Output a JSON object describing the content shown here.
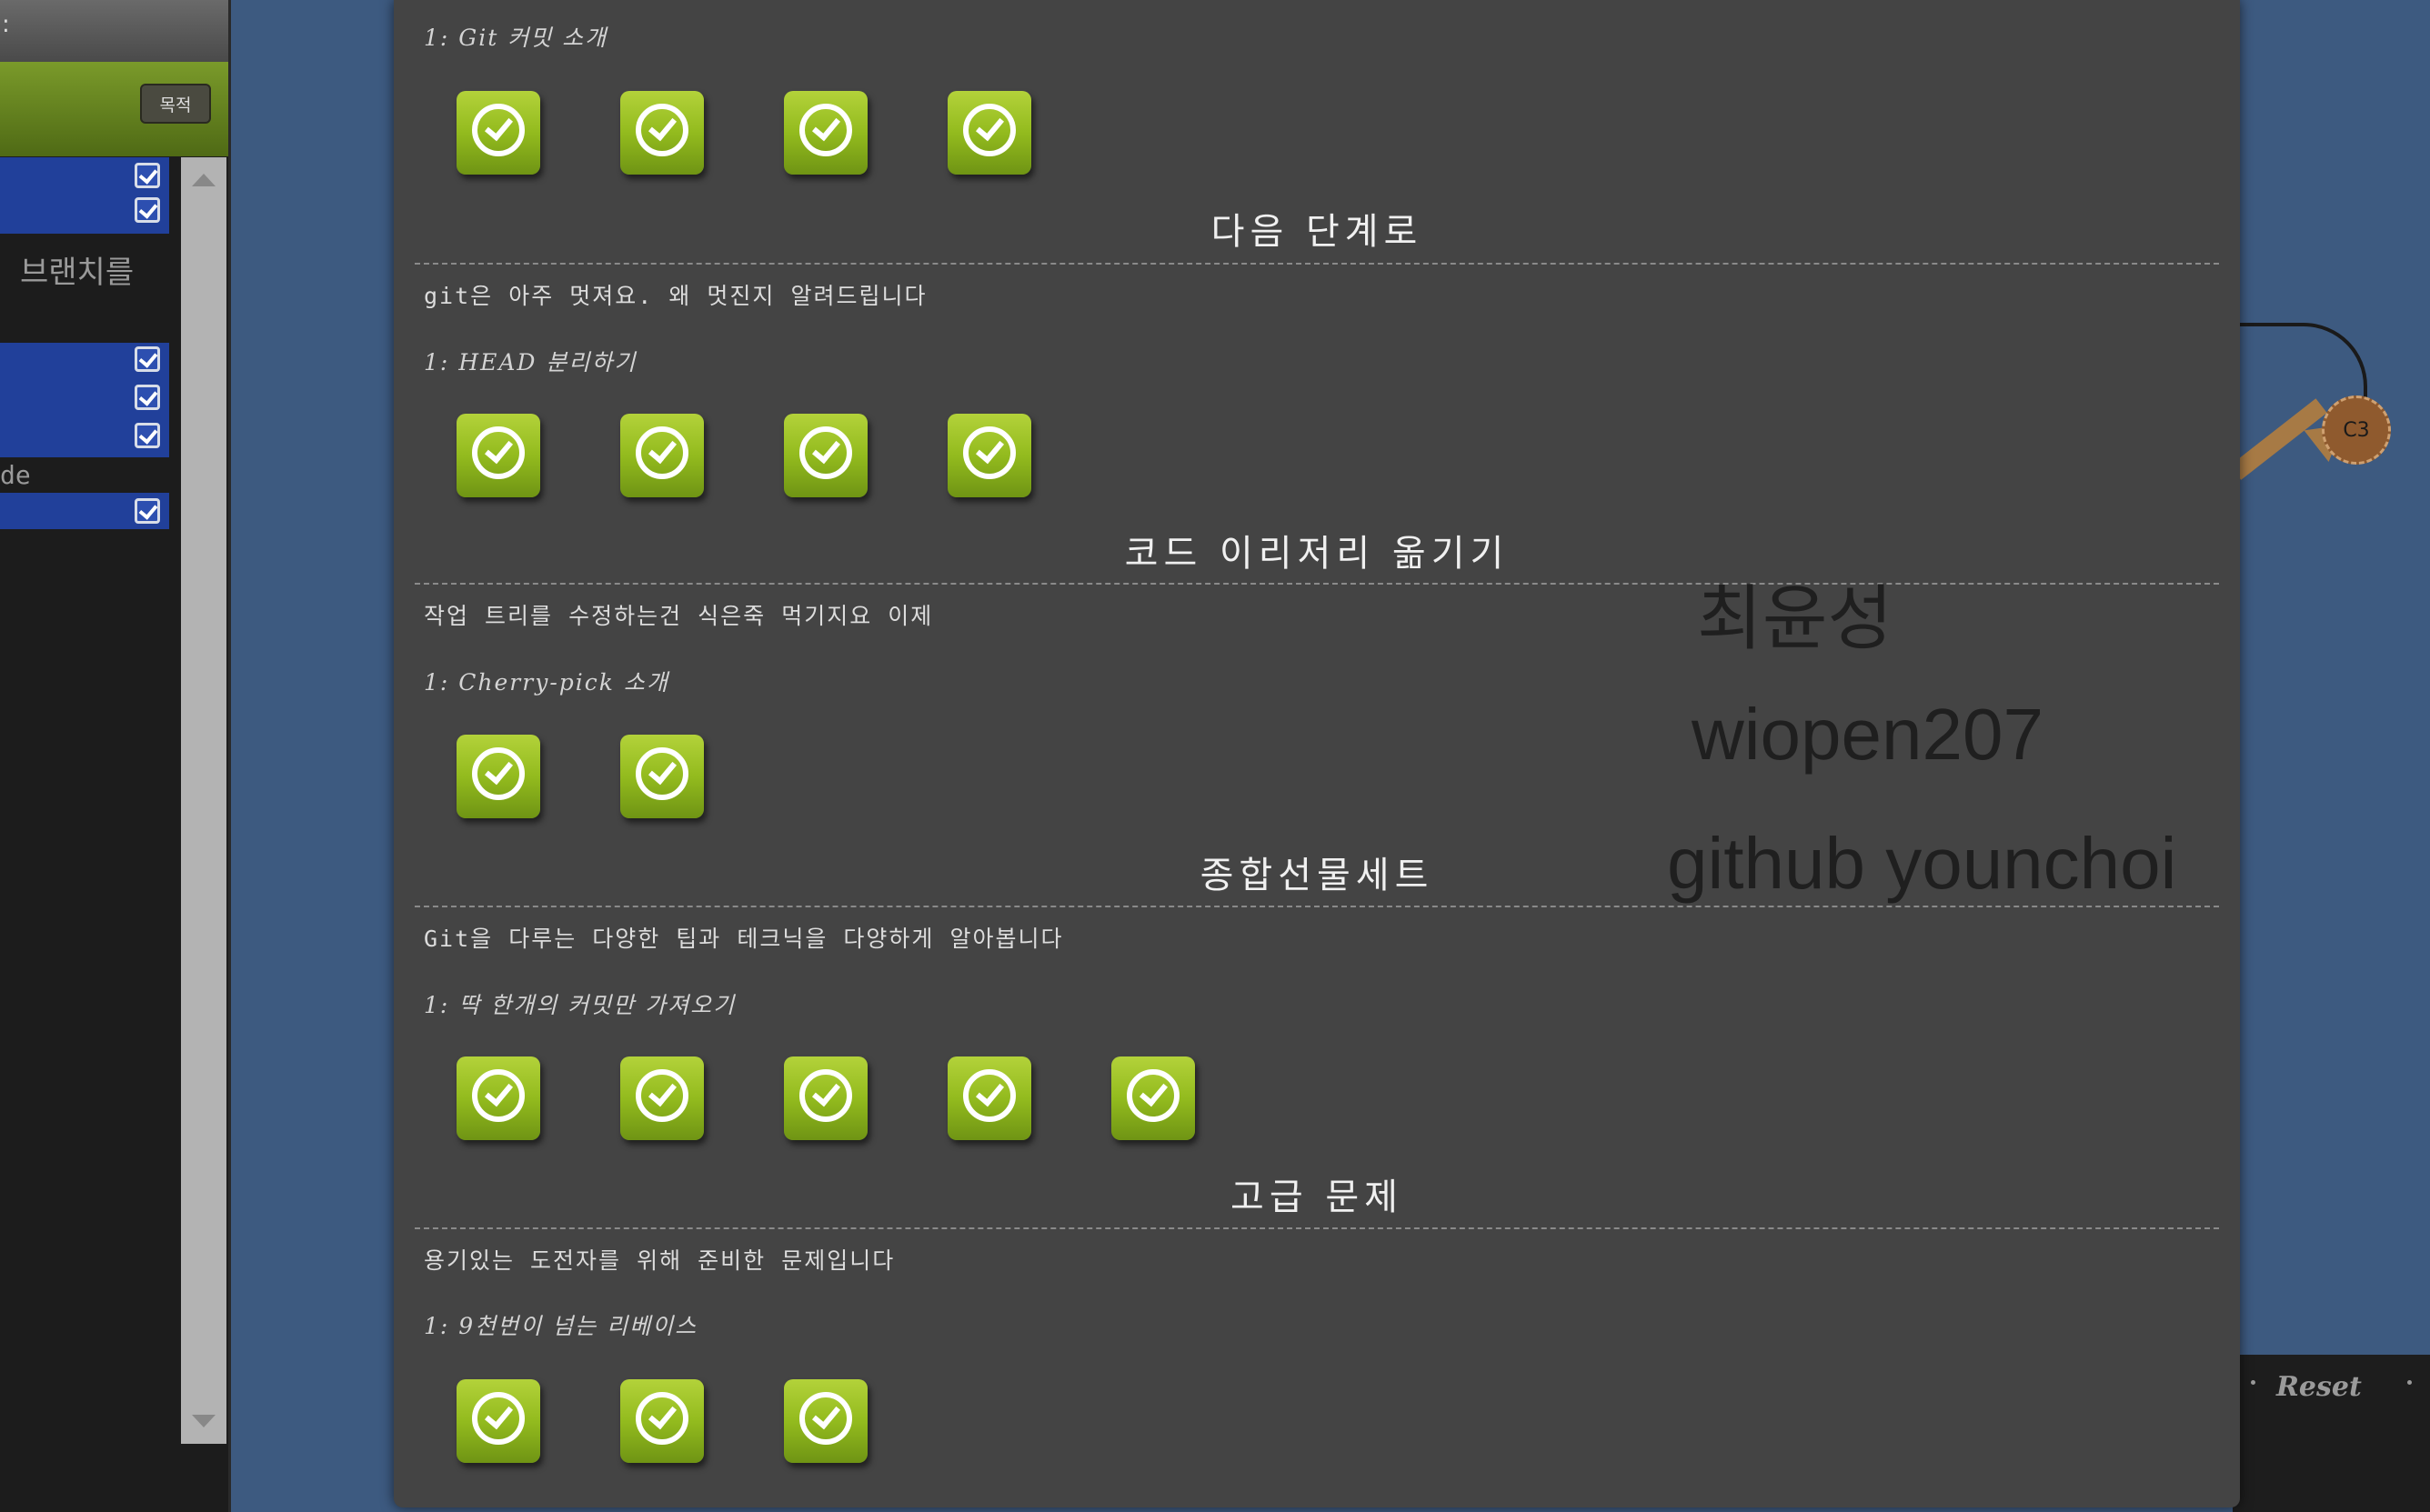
{
  "left_panel": {
    "top_bar_text": ":",
    "goal_button": "목적",
    "branch_text": "브랜치를",
    "side_text": "de"
  },
  "graph": {
    "commit_label": "C3",
    "reset_label": "Reset"
  },
  "sequences": [
    {
      "title": "",
      "about": "",
      "level_name": "1: Git 커밋 소개",
      "solved": [
        true,
        true,
        true,
        true
      ]
    },
    {
      "title": "다음 단계로",
      "about": "git은 아주 멋져요. 왜 멋진지 알려드립니다",
      "level_name": "1: HEAD 분리하기",
      "solved": [
        true,
        true,
        true,
        true
      ]
    },
    {
      "title": "코드 이리저리 옮기기",
      "about": "작업 트리를 수정하는건 식은죽 먹기지요 이제",
      "level_name": "1: Cherry-pick 소개",
      "solved": [
        true,
        true
      ]
    },
    {
      "title": "종합선물세트",
      "about": "Git을 다루는 다양한 팁과 테크닉을 다양하게 알아봅니다",
      "level_name": "1: 딱 한개의 커밋만 가져오기",
      "solved": [
        true,
        true,
        true,
        true,
        true
      ]
    },
    {
      "title": "고급 문제",
      "about": "용기있는 도전자를 위해 준비한 문제입니다",
      "level_name": "1: 9천번이 넘는 리베이스",
      "solved": [
        true,
        true,
        true
      ]
    }
  ],
  "overlay": {
    "name": "최윤성",
    "student_id": "wiopen207",
    "github": "github younchoi"
  }
}
